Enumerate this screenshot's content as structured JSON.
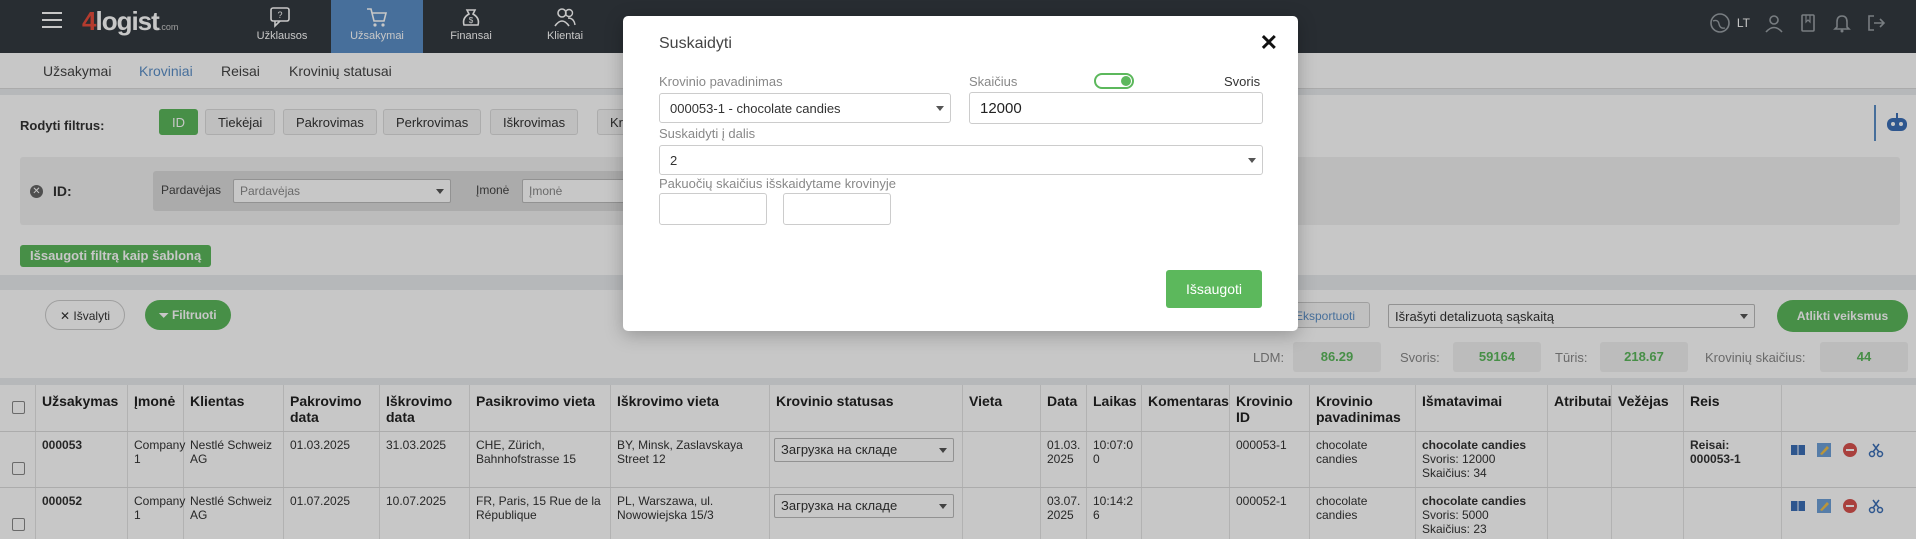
{
  "brand": {
    "logo_num": "4",
    "logo_text": "logist",
    "logo_suffix": ".com"
  },
  "topnav": [
    {
      "label": "Užklausos",
      "icon": "chat-question-icon"
    },
    {
      "label": "Užsakymai",
      "icon": "cart-icon",
      "active": true
    },
    {
      "label": "Finansai",
      "icon": "money-bag-icon"
    },
    {
      "label": "Klientai",
      "icon": "users-icon"
    }
  ],
  "topright": {
    "lang": "LT"
  },
  "subnav": [
    {
      "label": "Užsakymai"
    },
    {
      "label": "Kroviniai",
      "active": true
    },
    {
      "label": "Reisai"
    },
    {
      "label": "Krovinių statusai"
    }
  ],
  "filters": {
    "show_label": "Rodyti filtrus:",
    "chips": [
      "ID",
      "Tiekėjai",
      "Pakrovimas",
      "Perkrovimas",
      "Iškrovimas",
      "Kr"
    ],
    "id_label": "ID:",
    "seller_label": "Pardavėjas",
    "seller_placeholder": "Pardavėjas",
    "company_label": "Įmonė",
    "company_placeholder": "Įmonė",
    "save_template": "Išsaugoti filtrą kaip šabloną"
  },
  "actions": {
    "clear": "Išvalyti",
    "filter": "Filtruoti",
    "export": "Eksportuoti",
    "invoice_select": "Išrašyti detalizuotą sąskaitą",
    "perform": "Atlikti veiksmus"
  },
  "stats": {
    "ldm_label": "LDM:",
    "ldm_value": "86.29",
    "weight_label": "Svoris:",
    "weight_value": "59164",
    "volume_label": "Tūris:",
    "volume_value": "218.67",
    "count_label": "Krovinių skaičius:",
    "count_value": "44"
  },
  "table": {
    "headers": [
      "Užsakymas",
      "Įmonė",
      "Klientas",
      "Pakrovimo data",
      "Iškrovimo data",
      "Pasikrovimo vieta",
      "Iškrovimo vieta",
      "Krovinio statusas",
      "Vieta",
      "Data",
      "Laikas",
      "Komentaras",
      "Krovinio ID",
      "Krovinio pavadinimas",
      "Išmatavimai",
      "Atributai",
      "Vežėjas",
      "Reis"
    ],
    "rows": [
      {
        "order": "000053",
        "company": "Company 1",
        "client": "Nestlé Schweiz AG",
        "load_date": "01.03.2025",
        "unload_date": "31.03.2025",
        "load_place": "CHE, Zürich, Bahnhofstrasse 15",
        "unload_place": "BY, Minsk, Zaslavskaya Street 12",
        "status": "Загрузка на складе",
        "place": "",
        "date": "01.03. 2025",
        "time": "10:07:0 0",
        "comment": "",
        "cargo_id": "000053-1",
        "cargo_name": "chocolate candies",
        "dim_title": "chocolate candies",
        "dim_weight": "Svoris: 12000",
        "dim_count": "Skaičius: 34",
        "trip": "Reisai: 000053-1"
      },
      {
        "order": "000052",
        "company": "Company 1",
        "client": "Nestlé Schweiz AG",
        "load_date": "01.07.2025",
        "unload_date": "10.07.2025",
        "load_place": "FR, Paris, 15 Rue de la République",
        "unload_place": "PL, Warszawa, ul. Nowowiejska 15/3",
        "status": "Загрузка на складе",
        "place": "",
        "date": "03.07. 2025",
        "time": "10:14:2 6",
        "comment": "",
        "cargo_id": "000052-1",
        "cargo_name": "chocolate candies",
        "dim_title": "chocolate candies",
        "dim_weight": "Svoris: 5000",
        "dim_count": "Skaičius: 23",
        "trip": ""
      }
    ]
  },
  "modal": {
    "title": "Suskaidyti",
    "cargo_name_label": "Krovinio pavadinimas",
    "cargo_name_value": "000053-1 - chocolate candies",
    "count_label": "Skaičius",
    "weight_label": "Svoris",
    "count_value": "12000",
    "split_label": "Suskaidyti į dalis",
    "split_value": "2",
    "packages_label": "Pakuočių skaičius išskaidytame krovinyje",
    "package_1": "",
    "package_2": "",
    "save": "Išsaugoti"
  }
}
